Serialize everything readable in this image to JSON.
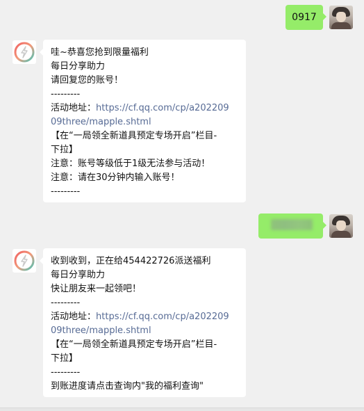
{
  "messages": [
    {
      "sender": "me",
      "text": "0917"
    },
    {
      "sender": "bot",
      "lines": [
        "哇~恭喜您抢到限量福利",
        "每日分享助力",
        "请回复您的账号！",
        "---------"
      ],
      "activity_label": "活动地址：",
      "activity_link_part1": "https://cf.qq.com/cp/a202209",
      "activity_link_part2": "09three/mapple.shtml",
      "bracket_line1": "【在“一局领全新道具预定专场开启”栏目-",
      "bracket_line2": "下拉】",
      "note1": "注意：账号等级低于1级无法参与活动！",
      "note2": "注意：请在30分钟内输入账号！",
      "divider": "---------"
    },
    {
      "sender": "me",
      "text": ""
    },
    {
      "sender": "bot",
      "lines": [
        "收到收到，正在给454422726派送福利",
        "每日分享助力",
        "快让朋友来一起领吧！",
        "---------"
      ],
      "activity_label": "活动地址：",
      "activity_link_part1": "https://cf.qq.com/cp/a202209",
      "activity_link_part2": "09three/mapple.shtml",
      "bracket_line1": "【在“一局领全新道具预定专场开启”栏目-",
      "bracket_line2": "下拉】",
      "divider": "---------",
      "footer": "到账进度请点击查询内\"我的福利查询\""
    }
  ],
  "colors": {
    "background": "#f0f0f0",
    "my_bubble": "#95ec69",
    "bot_bubble": "#ffffff",
    "link": "#576b95"
  },
  "icons": {
    "bot_avatar": "lightning-ring-icon",
    "user_avatar": "user-avatar"
  }
}
